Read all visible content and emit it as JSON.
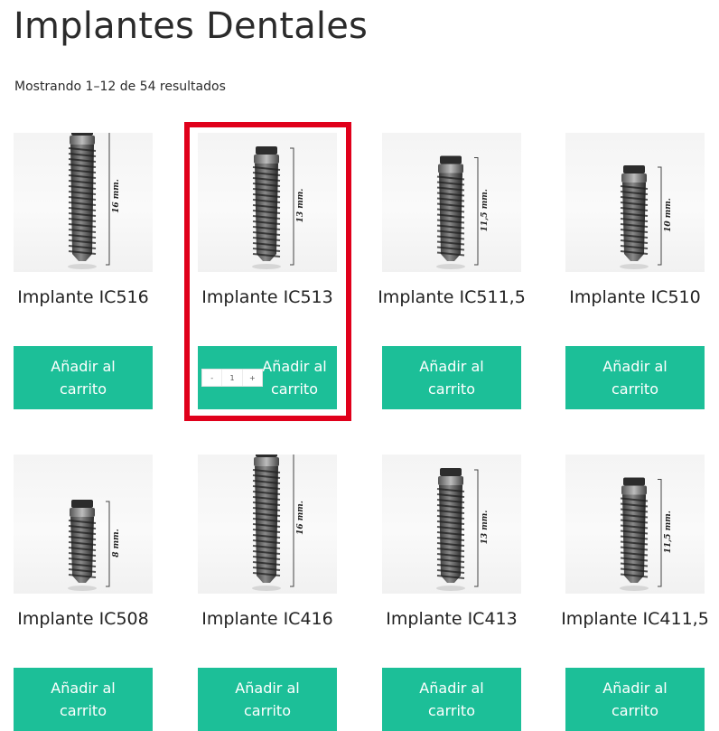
{
  "page": {
    "title": "Implantes Dentales",
    "result_count": "Mostrando 1–12 de 54 resultados"
  },
  "colors": {
    "button": "#1cbf98",
    "highlight": "#e0001b"
  },
  "products": [
    {
      "title": "Implante IC516",
      "length_label": "16 mm.",
      "button_label": "Añadir al carrito"
    },
    {
      "title": "Implante IC513",
      "length_label": "13 mm.",
      "button_label": "Añadir al carrito",
      "quantity": {
        "minus": "-",
        "value": "1",
        "plus": "+"
      }
    },
    {
      "title": "Implante IC511,5",
      "length_label": "11,5 mm.",
      "button_label": "Añadir al carrito"
    },
    {
      "title": "Implante IC510",
      "length_label": "10 mm.",
      "button_label": "Añadir al carrito"
    },
    {
      "title": "Implante IC508",
      "length_label": "8 mm.",
      "button_label": "Añadir al carrito"
    },
    {
      "title": "Implante IC416",
      "length_label": "16 mm.",
      "button_label": "Añadir al carrito"
    },
    {
      "title": "Implante IC413",
      "length_label": "13 mm.",
      "button_label": "Añadir al carrito"
    },
    {
      "title": "Implante IC411,5",
      "length_label": "11,5 mm.",
      "button_label": "Añadir al carrito"
    }
  ]
}
